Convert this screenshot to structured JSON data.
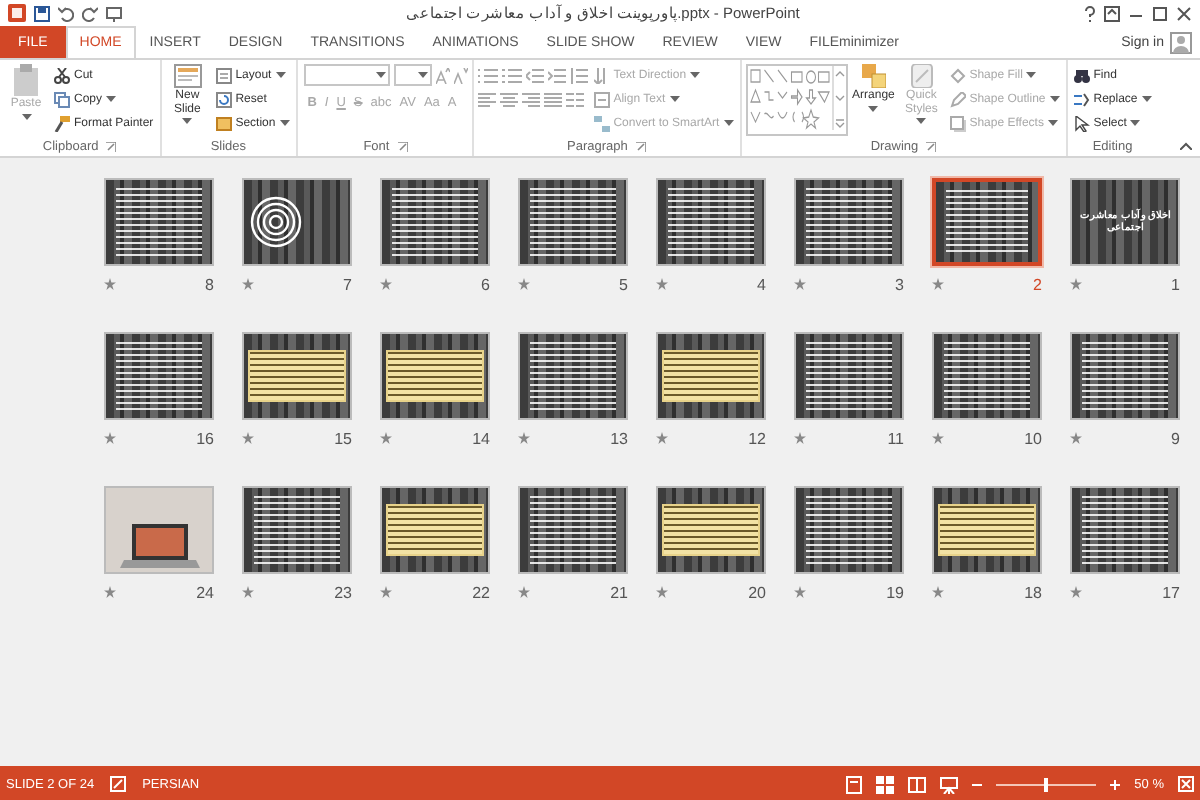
{
  "window": {
    "title": "پاورپوینت اخلاق و آداب معاشرت اجتماعی.pptx - PowerPoint",
    "sign_in": "Sign in"
  },
  "tabs": [
    {
      "label": "FILE",
      "kind": "file",
      "selected": false
    },
    {
      "label": "HOME",
      "kind": "tab",
      "selected": true
    },
    {
      "label": "INSERT",
      "kind": "tab",
      "selected": false
    },
    {
      "label": "DESIGN",
      "kind": "tab",
      "selected": false
    },
    {
      "label": "TRANSITIONS",
      "kind": "tab",
      "selected": false
    },
    {
      "label": "ANIMATIONS",
      "kind": "tab",
      "selected": false
    },
    {
      "label": "SLIDE SHOW",
      "kind": "tab",
      "selected": false
    },
    {
      "label": "REVIEW",
      "kind": "tab",
      "selected": false
    },
    {
      "label": "VIEW",
      "kind": "tab",
      "selected": false
    },
    {
      "label": "FILEminimizer",
      "kind": "tab",
      "selected": false
    }
  ],
  "ribbon": {
    "clipboard": {
      "label": "Clipboard",
      "paste": {
        "label": "Paste",
        "disabled": true
      },
      "cut": {
        "label": "Cut",
        "disabled": false
      },
      "copy": {
        "label": "Copy",
        "disabled": false
      },
      "format_painter": {
        "label": "Format Painter",
        "disabled": false
      }
    },
    "slides": {
      "label": "Slides",
      "new_slide": {
        "label": "New Slide",
        "disabled": false
      },
      "layout": {
        "label": "Layout",
        "disabled": false
      },
      "reset": {
        "label": "Reset",
        "disabled": false
      },
      "section": {
        "label": "Section",
        "disabled": false
      }
    },
    "font": {
      "label": "Font",
      "disabled": true,
      "buttons": [
        "B",
        "I",
        "U",
        "S",
        "abc",
        "AV",
        "Aa",
        "A"
      ]
    },
    "paragraph": {
      "label": "Paragraph",
      "text_direction": {
        "label": "Text Direction",
        "disabled": true
      },
      "align_text": {
        "label": "Align Text",
        "disabled": true
      },
      "convert": {
        "label": "Convert to SmartArt",
        "disabled": true
      }
    },
    "drawing": {
      "label": "Drawing",
      "arrange": {
        "label": "Arrange",
        "disabled": false
      },
      "quick_styles": {
        "label": "Quick Styles",
        "disabled": true
      },
      "shape_fill": {
        "label": "Shape Fill",
        "disabled": true
      },
      "shape_outline": {
        "label": "Shape Outline",
        "disabled": true
      },
      "shape_effects": {
        "label": "Shape Effects",
        "disabled": true
      }
    },
    "editing": {
      "label": "Editing",
      "find": {
        "label": "Find",
        "disabled": false
      },
      "replace": {
        "label": "Replace",
        "disabled": false
      },
      "select": {
        "label": "Select",
        "disabled": false
      }
    }
  },
  "slides": [
    {
      "number": "8",
      "kind": "text",
      "selected": false
    },
    {
      "number": "7",
      "kind": "target",
      "selected": false
    },
    {
      "number": "6",
      "kind": "text",
      "selected": false
    },
    {
      "number": "5",
      "kind": "text",
      "selected": false
    },
    {
      "number": "4",
      "kind": "text",
      "selected": false
    },
    {
      "number": "3",
      "kind": "text",
      "selected": false
    },
    {
      "number": "2",
      "kind": "text",
      "selected": true
    },
    {
      "number": "1",
      "kind": "title",
      "title": "اخلاق و آداب معاشرت اجتماعی",
      "selected": false
    },
    {
      "number": "16",
      "kind": "text",
      "selected": false
    },
    {
      "number": "15",
      "kind": "beige",
      "selected": false
    },
    {
      "number": "14",
      "kind": "beige",
      "selected": false
    },
    {
      "number": "13",
      "kind": "text",
      "selected": false
    },
    {
      "number": "12",
      "kind": "beige",
      "selected": false
    },
    {
      "number": "11",
      "kind": "text",
      "selected": false
    },
    {
      "number": "10",
      "kind": "text",
      "selected": false
    },
    {
      "number": "9",
      "kind": "text",
      "selected": false
    },
    {
      "number": "24",
      "kind": "photo",
      "selected": false
    },
    {
      "number": "23",
      "kind": "text",
      "selected": false
    },
    {
      "number": "22",
      "kind": "beige",
      "selected": false
    },
    {
      "number": "21",
      "kind": "text",
      "selected": false
    },
    {
      "number": "20",
      "kind": "beige",
      "selected": false
    },
    {
      "number": "19",
      "kind": "text",
      "selected": false
    },
    {
      "number": "18",
      "kind": "beige",
      "selected": false
    },
    {
      "number": "17",
      "kind": "text",
      "selected": false
    }
  ],
  "status_bar": {
    "slide": "SLIDE 2 OF 24",
    "language": "PERSIAN",
    "zoom": "50 %",
    "zoom_slider": {
      "level": 0.5
    }
  }
}
